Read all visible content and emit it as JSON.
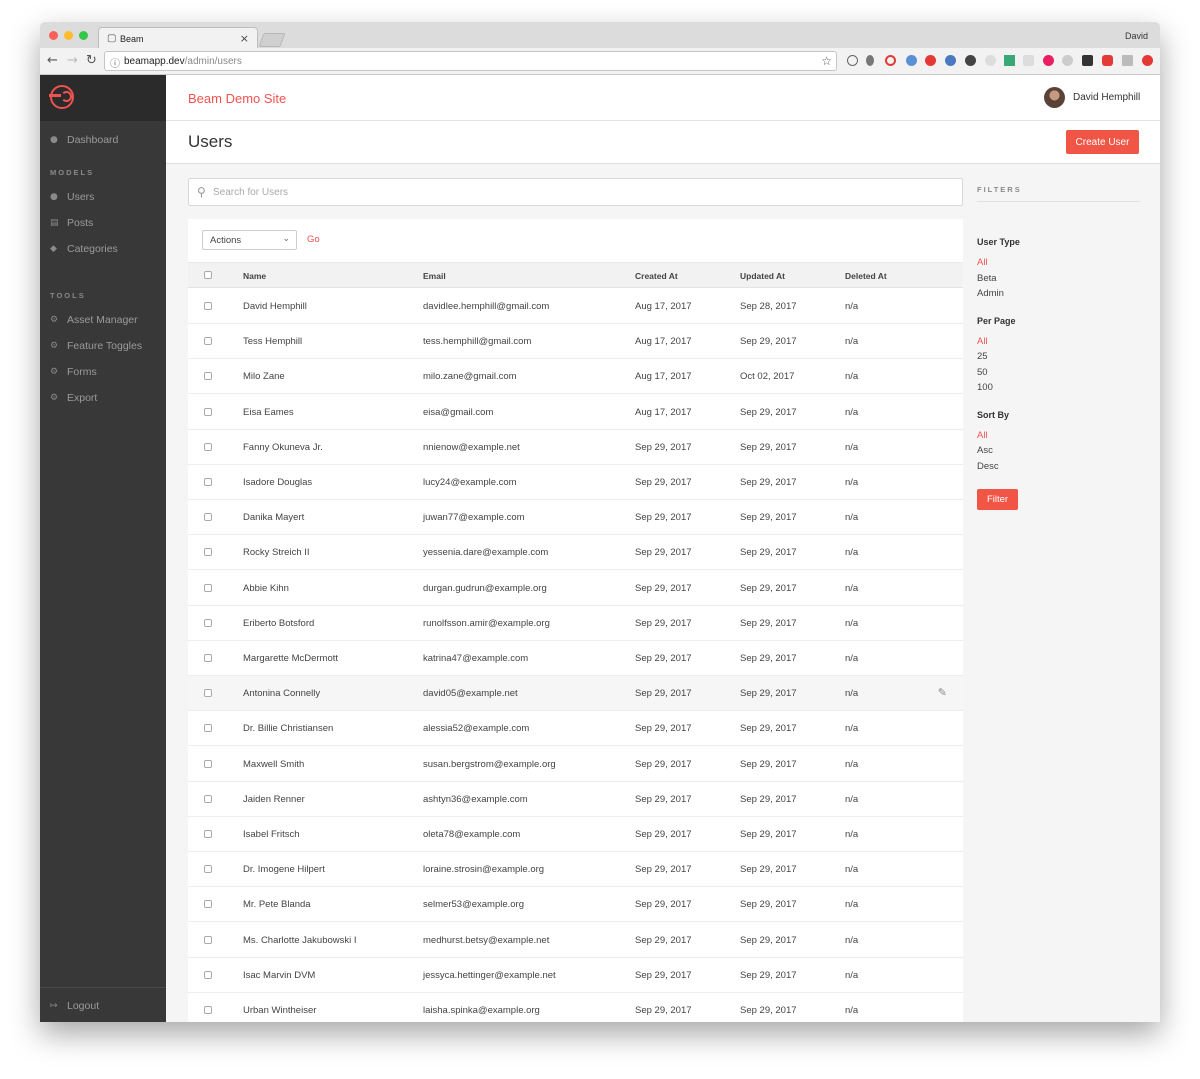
{
  "browser": {
    "tab_title": "Beam",
    "profile": "David",
    "url_host": "beamapp.dev",
    "url_path": "/admin/users"
  },
  "app": {
    "site_title": "Beam Demo Site",
    "user_name": "David Hemphill",
    "accent": "#ef5350",
    "sidebar_bg": "#383838"
  },
  "sidebar": {
    "dashboard": {
      "label": "Dashboard",
      "icon": "dashboard-icon"
    },
    "models_heading": "MODELS",
    "models": [
      {
        "label": "Users",
        "icon": "users-icon"
      },
      {
        "label": "Posts",
        "icon": "document-icon"
      },
      {
        "label": "Categories",
        "icon": "tag-icon"
      }
    ],
    "tools_heading": "TOOLS",
    "tools": [
      {
        "label": "Asset Manager",
        "icon": "gear-icon"
      },
      {
        "label": "Feature Toggles",
        "icon": "gear-icon"
      },
      {
        "label": "Forms",
        "icon": "gear-icon"
      },
      {
        "label": "Export",
        "icon": "gear-icon"
      }
    ],
    "logout": "Logout"
  },
  "page": {
    "title": "Users",
    "create_button": "Create User",
    "search_placeholder": "Search for Users",
    "actions_select": "Actions",
    "go_label": "Go"
  },
  "table": {
    "columns": [
      "Name",
      "Email",
      "Created At",
      "Updated At",
      "Deleted At"
    ],
    "rows": [
      [
        "David Hemphill",
        "davidlee.hemphill@gmail.com",
        "Aug 17, 2017",
        "Sep 28, 2017",
        "n/a"
      ],
      [
        "Tess Hemphill",
        "tess.hemphill@gmail.com",
        "Aug 17, 2017",
        "Sep 29, 2017",
        "n/a"
      ],
      [
        "Milo Zane",
        "milo.zane@gmail.com",
        "Aug 17, 2017",
        "Oct 02, 2017",
        "n/a"
      ],
      [
        "Eisa Eames",
        "eisa@gmail.com",
        "Aug 17, 2017",
        "Sep 29, 2017",
        "n/a"
      ],
      [
        "Fanny Okuneva Jr.",
        "nnienow@example.net",
        "Sep 29, 2017",
        "Sep 29, 2017",
        "n/a"
      ],
      [
        "Isadore Douglas",
        "lucy24@example.com",
        "Sep 29, 2017",
        "Sep 29, 2017",
        "n/a"
      ],
      [
        "Danika Mayert",
        "juwan77@example.com",
        "Sep 29, 2017",
        "Sep 29, 2017",
        "n/a"
      ],
      [
        "Rocky Streich II",
        "yessenia.dare@example.com",
        "Sep 29, 2017",
        "Sep 29, 2017",
        "n/a"
      ],
      [
        "Abbie Kihn",
        "durgan.gudrun@example.org",
        "Sep 29, 2017",
        "Sep 29, 2017",
        "n/a"
      ],
      [
        "Eriberto Botsford",
        "runolfsson.amir@example.org",
        "Sep 29, 2017",
        "Sep 29, 2017",
        "n/a"
      ],
      [
        "Margarette McDermott",
        "katrina47@example.com",
        "Sep 29, 2017",
        "Sep 29, 2017",
        "n/a"
      ],
      [
        "Antonina Connelly",
        "david05@example.net",
        "Sep 29, 2017",
        "Sep 29, 2017",
        "n/a"
      ],
      [
        "Dr. Billie Christiansen",
        "alessia52@example.com",
        "Sep 29, 2017",
        "Sep 29, 2017",
        "n/a"
      ],
      [
        "Maxwell Smith",
        "susan.bergstrom@example.org",
        "Sep 29, 2017",
        "Sep 29, 2017",
        "n/a"
      ],
      [
        "Jaiden Renner",
        "ashtyn36@example.com",
        "Sep 29, 2017",
        "Sep 29, 2017",
        "n/a"
      ],
      [
        "Isabel Fritsch",
        "oleta78@example.com",
        "Sep 29, 2017",
        "Sep 29, 2017",
        "n/a"
      ],
      [
        "Dr. Imogene Hilpert",
        "loraine.strosin@example.org",
        "Sep 29, 2017",
        "Sep 29, 2017",
        "n/a"
      ],
      [
        "Mr. Pete Blanda",
        "selmer53@example.org",
        "Sep 29, 2017",
        "Sep 29, 2017",
        "n/a"
      ],
      [
        "Ms. Charlotte Jakubowski I",
        "medhurst.betsy@example.net",
        "Sep 29, 2017",
        "Sep 29, 2017",
        "n/a"
      ],
      [
        "Isac Marvin DVM",
        "jessyca.hettinger@example.net",
        "Sep 29, 2017",
        "Sep 29, 2017",
        "n/a"
      ],
      [
        "Urban Wintheiser",
        "laisha.spinka@example.org",
        "Sep 29, 2017",
        "Sep 29, 2017",
        "n/a"
      ]
    ],
    "hovered_row": 11
  },
  "filters": {
    "heading": "FILTERS",
    "groups": [
      {
        "title": "User Type",
        "options": [
          "All",
          "Beta",
          "Admin"
        ],
        "active": "All"
      },
      {
        "title": "Per Page",
        "options": [
          "All",
          "25",
          "50",
          "100"
        ],
        "active": "All"
      },
      {
        "title": "Sort By",
        "options": [
          "All",
          "Asc",
          "Desc"
        ],
        "active": "All"
      }
    ],
    "button": "Filter"
  }
}
